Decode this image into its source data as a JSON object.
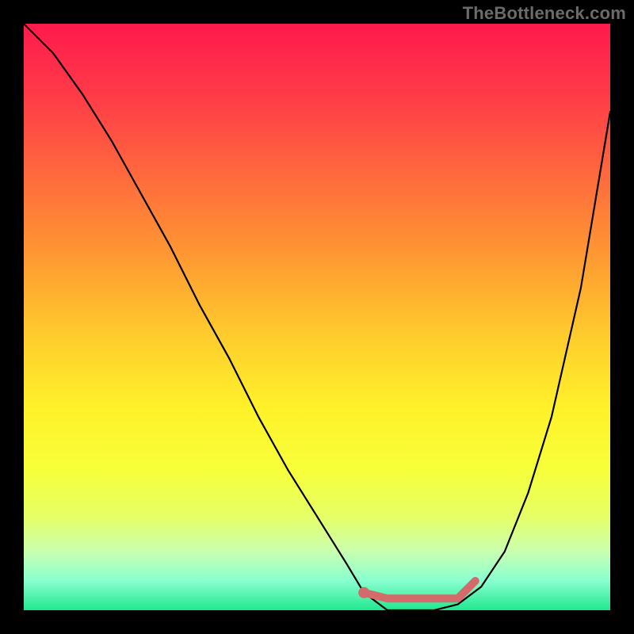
{
  "watermark": "TheBottleneck.com",
  "chart_data": {
    "type": "line",
    "title": "",
    "xlabel": "",
    "ylabel": "",
    "xlim": [
      0,
      1
    ],
    "ylim": [
      0,
      1
    ],
    "series": [
      {
        "name": "curve",
        "x": [
          0.0,
          0.05,
          0.1,
          0.15,
          0.2,
          0.25,
          0.3,
          0.35,
          0.4,
          0.45,
          0.5,
          0.55,
          0.58,
          0.62,
          0.66,
          0.7,
          0.74,
          0.78,
          0.82,
          0.86,
          0.9,
          0.95,
          1.0
        ],
        "y": [
          1.0,
          0.95,
          0.88,
          0.8,
          0.71,
          0.62,
          0.52,
          0.43,
          0.33,
          0.24,
          0.16,
          0.08,
          0.03,
          0.0,
          0.0,
          0.0,
          0.01,
          0.04,
          0.1,
          0.2,
          0.33,
          0.55,
          0.85
        ]
      },
      {
        "name": "highlight",
        "x": [
          0.58,
          0.62,
          0.66,
          0.7,
          0.74,
          0.77
        ],
        "y": [
          0.03,
          0.02,
          0.02,
          0.02,
          0.02,
          0.05
        ]
      }
    ],
    "marker": {
      "x": 0.58,
      "y": 0.03
    },
    "background_gradient": {
      "top": "#ff1a4d",
      "bottom": "#20e88f"
    }
  }
}
